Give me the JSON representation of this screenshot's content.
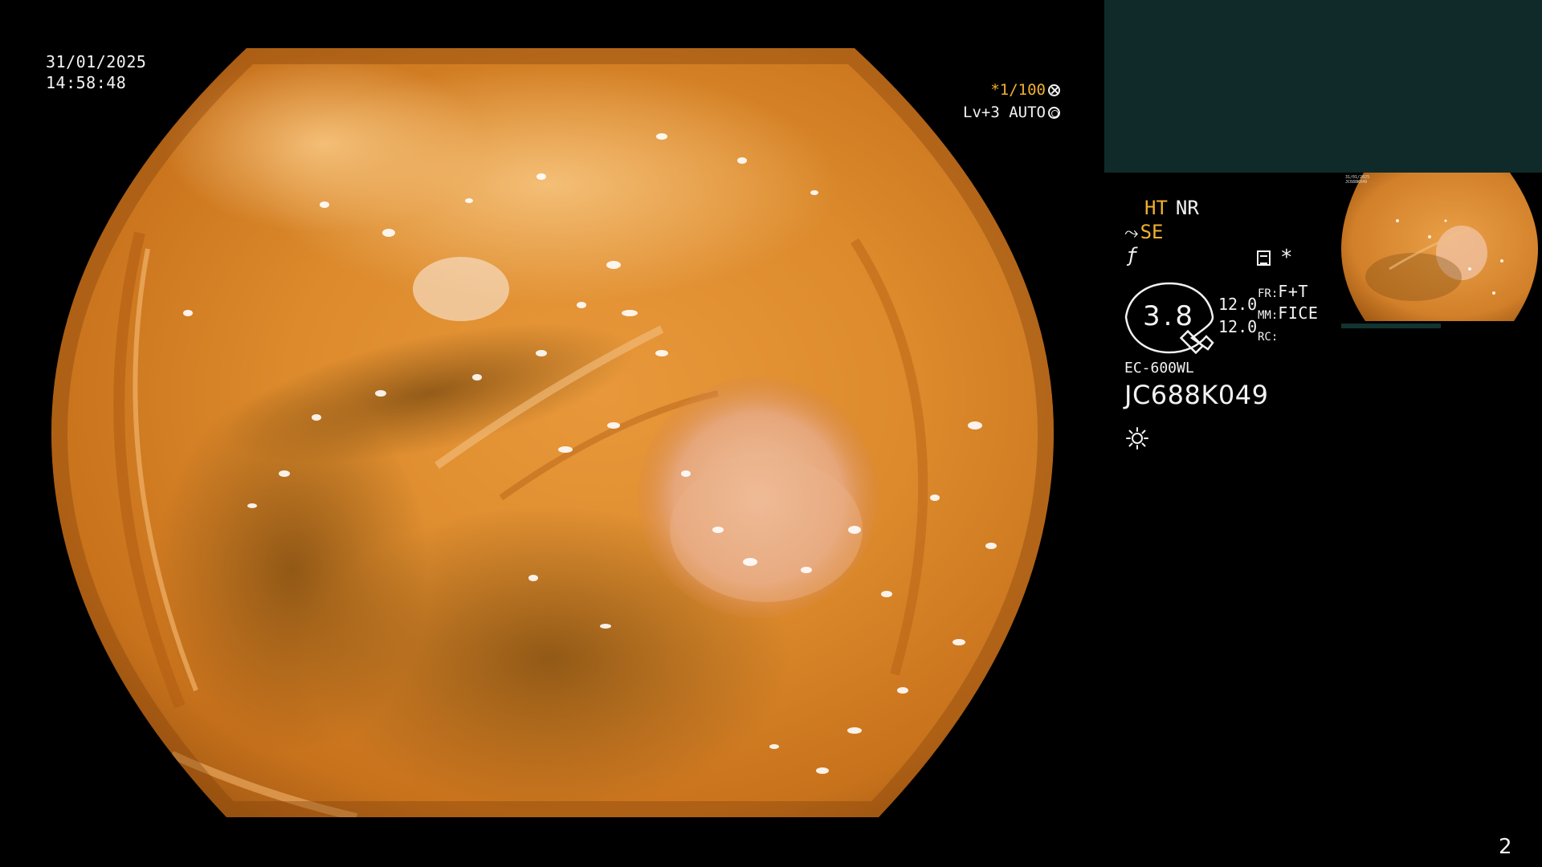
{
  "overlay": {
    "date": "31/01/2025",
    "time": "14:58:48",
    "shutter": "*1/100",
    "level": "Lv+3 AUTO",
    "aperture_icon": "aperture-icon",
    "auto_icon": "auto-exposure-icon"
  },
  "info": {
    "ht_label": "HT",
    "nr_label": "NR",
    "se_label": "SE",
    "hook_icon": "hook-icon",
    "f_symbol": "ƒ",
    "memo_icon": "memo-icon",
    "asterisk": "*",
    "scope_value": "3.8",
    "num_top": "12.0",
    "num_bottom": "12.0",
    "fr_label": "FR:",
    "fr_value": "F+T",
    "mm_label": "MM:",
    "mm_value": "FICE",
    "rc_label": "RC:",
    "rc_value": "",
    "model": "EC-600WL",
    "serial": "JC688K049",
    "light_icon": "light-icon"
  },
  "thumbnail": {
    "date": "31/01/2025",
    "serial": "JC688K049"
  },
  "page_number": "2",
  "colors": {
    "accent": "#f0b030",
    "teal_panel": "#0f2a29",
    "text": "#f2f2f2",
    "background": "#000000"
  }
}
